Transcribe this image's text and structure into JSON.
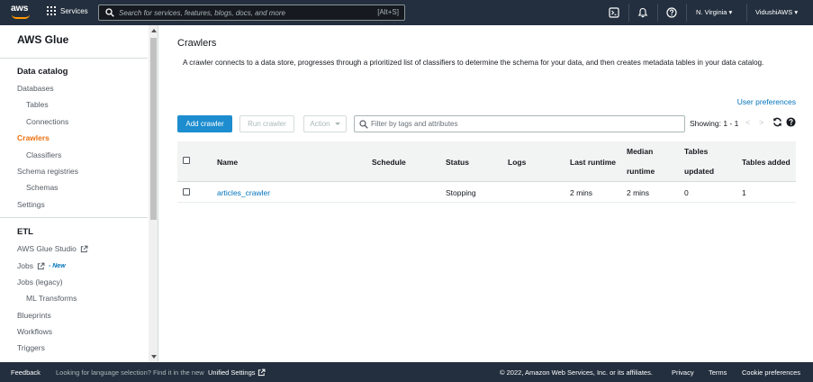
{
  "topnav": {
    "logo_text": "aws",
    "services_label": "Services",
    "search_placeholder": "Search for services, features, blogs, docs, and more",
    "search_shortcut": "[Alt+S]",
    "region": "N. Virginia ▾",
    "account": "VidushiAWS ▾"
  },
  "sidebar": {
    "title": "AWS Glue",
    "data_catalog_header": "Data catalog",
    "items": {
      "databases": "Databases",
      "tables": "Tables",
      "connections": "Connections",
      "crawlers": "Crawlers",
      "classifiers": "Classifiers",
      "schema_registries": "Schema registries",
      "schemas": "Schemas",
      "settings": "Settings"
    },
    "etl_header": "ETL",
    "etl_items": {
      "glue_studio": "AWS Glue Studio",
      "jobs": "Jobs",
      "jobs_new": "- New",
      "jobs_legacy": "Jobs (legacy)",
      "ml_transforms": "ML Transforms",
      "blueprints": "Blueprints",
      "workflows": "Workflows",
      "triggers": "Triggers"
    }
  },
  "main": {
    "title": "Crawlers",
    "description": "A crawler connects to a data store, progresses through a prioritized list of classifiers to determine the schema for your data, and then creates metadata tables in your data catalog.",
    "user_preferences": "User preferences",
    "add_crawler": "Add crawler",
    "run_crawler": "Run crawler",
    "action": "Action",
    "filter_placeholder": "Filter by tags and attributes",
    "showing": "Showing: 1 - 1",
    "prev": "<",
    "next": ">"
  },
  "table": {
    "headers": {
      "name": "Name",
      "schedule": "Schedule",
      "status": "Status",
      "logs": "Logs",
      "last_runtime": "Last runtime",
      "median_1": "Median",
      "median_2": "runtime",
      "tables_updated_1": "Tables",
      "tables_updated_2": "updated",
      "tables_added": "Tables added"
    },
    "rows": [
      {
        "name": "articles_crawler",
        "schedule": "",
        "status": "Stopping",
        "logs": "",
        "last_runtime": "2 mins",
        "median_runtime": "2 mins",
        "tables_updated": "0",
        "tables_added": "1"
      }
    ]
  },
  "footer": {
    "feedback": "Feedback",
    "language_text": "Looking for language selection? Find it in the new",
    "unified_settings": "Unified Settings",
    "copyright": "© 2022, Amazon Web Services, Inc. or its affiliates.",
    "privacy": "Privacy",
    "terms": "Terms",
    "cookie": "Cookie preferences"
  },
  "colors": {
    "nav_bg": "#232f3e",
    "accent_orange": "#ec7211",
    "link_blue": "#0073bb",
    "primary_button": "#1d8dcf"
  }
}
